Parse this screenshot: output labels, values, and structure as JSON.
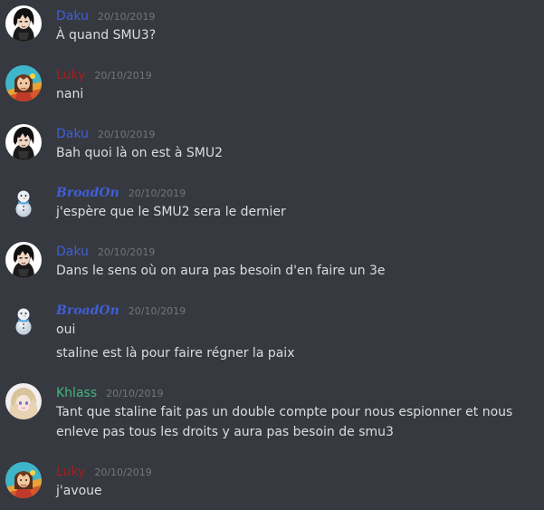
{
  "messages": [
    {
      "author": "Daku",
      "author_color": "#3f5fd6",
      "avatar": "daku-avatar",
      "timestamp": "20/10/2019",
      "lines": [
        "À quand SMU3?"
      ]
    },
    {
      "author": "Luky",
      "author_color": "#a51f1f",
      "avatar": "luky-avatar",
      "timestamp": "20/10/2019",
      "lines": [
        "nani"
      ]
    },
    {
      "author": "Daku",
      "author_color": "#3f5fd6",
      "avatar": "daku-avatar",
      "timestamp": "20/10/2019",
      "lines": [
        "Bah quoi là on est à SMU2"
      ]
    },
    {
      "author": "BroadOn",
      "author_color": "#3f5fd6",
      "avatar": "snowman-avatar",
      "timestamp": "20/10/2019",
      "lines": [
        "j'espère que le SMU2 sera le dernier"
      ]
    },
    {
      "author": "Daku",
      "author_color": "#3f5fd6",
      "avatar": "daku-avatar",
      "timestamp": "20/10/2019",
      "lines": [
        "Dans le sens où on aura pas besoin d'en faire un 3e"
      ]
    },
    {
      "author": "BroadOn",
      "author_color": "#3f5fd6",
      "avatar": "snowman-avatar",
      "timestamp": "20/10/2019",
      "lines": [
        "oui",
        "staline est là pour faire régner la paix"
      ]
    },
    {
      "author": "Khlass",
      "author_color": "#43b581",
      "avatar": "khlass-avatar",
      "timestamp": "20/10/2019",
      "lines": [
        "Tant que staline fait pas un double compte pour nous espionner et nous enleve pas tous les droits y aura pas besoin de smu3"
      ]
    },
    {
      "author": "Luky",
      "author_color": "#a51f1f",
      "avatar": "luky-avatar",
      "timestamp": "20/10/2019",
      "lines": [
        "j'avoue"
      ]
    }
  ],
  "colors": {
    "background": "#36393f",
    "text": "#dcddde",
    "timestamp": "#72767d"
  }
}
